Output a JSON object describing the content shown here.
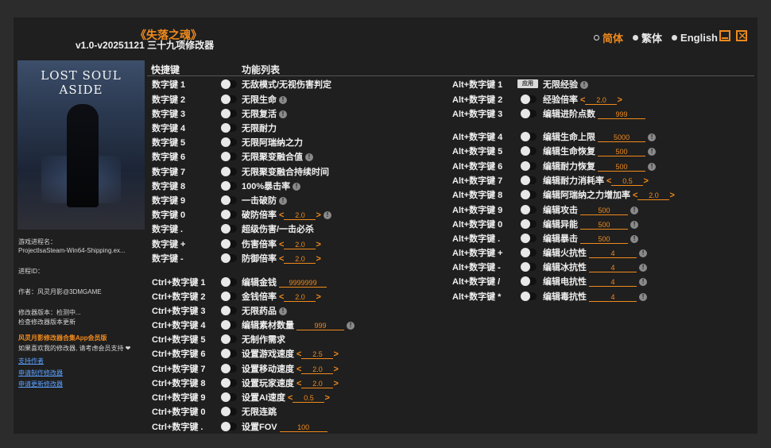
{
  "title": {
    "game": "《失落之魂》",
    "version": "v1.0-v20251121 三十九项修改器"
  },
  "languages": [
    {
      "label": "简体",
      "active": true
    },
    {
      "label": "繁体",
      "active": false
    },
    {
      "label": "English",
      "active": false
    }
  ],
  "window_controls": {
    "close_glyph": "✕"
  },
  "cover": {
    "title": "LOST SOUL ASIDE"
  },
  "info": {
    "process_label": "游戏进程名：",
    "process_name": "ProjectlsaSteam-Win64-Shipping.ex...",
    "pid_label": "进程ID：",
    "author": "作者：风灵月影@3DMGAME",
    "version_status": "修改器版本：检测中...",
    "check_update": "检查修改器版本更新",
    "promo": "风灵月影修改器合集App会员版",
    "support_text": "如果喜欢我的修改器, 请考虑会员支持 ❤",
    "links": [
      "支持作者",
      "申请制作修改器",
      "申请更新修改器"
    ]
  },
  "headers": {
    "hotkey": "快捷键",
    "features": "功能列表"
  },
  "icons": {
    "alert": "!",
    "left_arrow": "<",
    "right_arrow": ">",
    "apply": "应用"
  },
  "left_rows": [
    {
      "key": "数字键 1",
      "name": "无敌模式/无视伤害判定",
      "alert": false
    },
    {
      "key": "数字键 2",
      "name": "无限生命",
      "alert": true
    },
    {
      "key": "数字键 3",
      "name": "无限复活",
      "alert": true
    },
    {
      "key": "数字键 4",
      "name": "无限耐力",
      "alert": false
    },
    {
      "key": "数字键 5",
      "name": "无限阿瑞纳之力",
      "alert": false
    },
    {
      "key": "数字键 6",
      "name": "无限聚变融合值",
      "alert": true
    },
    {
      "key": "数字键 7",
      "name": "无限聚变融合持续时间",
      "alert": false
    },
    {
      "key": "数字键 8",
      "name": "100%暴击率",
      "alert": true
    },
    {
      "key": "数字键 9",
      "name": "一击破防",
      "alert": true
    },
    {
      "key": "数字键 0",
      "name": "破防倍率",
      "value": "2.0",
      "arrows": true,
      "alert": true
    },
    {
      "key": "数字键 .",
      "name": "超级伤害/一击必杀",
      "alert": false
    },
    {
      "key": "数字键 +",
      "name": "伤害倍率",
      "value": "2.0",
      "arrows": true,
      "alert": false
    },
    {
      "key": "数字键 -",
      "name": "防御倍率",
      "value": "2.0",
      "arrows": true,
      "alert": false
    },
    {
      "key": "Ctrl+数字键 1",
      "name": "编辑金钱",
      "value": "9999999",
      "arrows": false,
      "alert": false
    },
    {
      "key": "Ctrl+数字键 2",
      "name": "金钱倍率",
      "value": "2.0",
      "arrows": true,
      "alert": false
    },
    {
      "key": "Ctrl+数字键 3",
      "name": "无限药品",
      "alert": true
    },
    {
      "key": "Ctrl+数字键 4",
      "name": "编辑素材数量",
      "value": "999",
      "arrows": false,
      "alert": true
    },
    {
      "key": "Ctrl+数字键 5",
      "name": "无制作需求",
      "alert": false
    },
    {
      "key": "Ctrl+数字键 6",
      "name": "设置游戏速度",
      "value": "2.5",
      "arrows": true,
      "alert": false
    },
    {
      "key": "Ctrl+数字键 7",
      "name": "设置移动速度",
      "value": "2.0",
      "arrows": true,
      "alert": false
    },
    {
      "key": "Ctrl+数字键 8",
      "name": "设置玩家速度",
      "value": "2.0",
      "arrows": true,
      "alert": false
    },
    {
      "key": "Ctrl+数字键 9",
      "name": "设置AI速度",
      "value": "0.5",
      "arrows": true,
      "alert": false
    },
    {
      "key": "Ctrl+数字键 0",
      "name": "无限连跳",
      "alert": false
    },
    {
      "key": "Ctrl+数字键 .",
      "name": "设置FOV",
      "value": "100",
      "arrows": false,
      "alert": false
    }
  ],
  "right_rows": [
    {
      "key": "Alt+数字键 1",
      "name": "无限经验",
      "apply": true,
      "alert": true
    },
    {
      "key": "Alt+数字键 2",
      "name": "经验倍率",
      "value": "2.0",
      "arrows": true,
      "alert": false
    },
    {
      "key": "Alt+数字键 3",
      "name": "编辑进阶点数",
      "value": "999",
      "arrows": false,
      "alert": false
    },
    {
      "key": "Alt+数字键 4",
      "name": "编辑生命上限",
      "value": "5000",
      "arrows": false,
      "alert": true
    },
    {
      "key": "Alt+数字键 5",
      "name": "编辑生命恢复",
      "value": "500",
      "arrows": false,
      "alert": true
    },
    {
      "key": "Alt+数字键 6",
      "name": "编辑耐力恢复",
      "value": "500",
      "arrows": false,
      "alert": true
    },
    {
      "key": "Alt+数字键 7",
      "name": "编辑耐力消耗率",
      "value": "0.5",
      "arrows": true,
      "alert": false
    },
    {
      "key": "Alt+数字键 8",
      "name": "编辑阿瑞纳之力增加率",
      "value": "2.0",
      "arrows": true,
      "alert": false
    },
    {
      "key": "Alt+数字键 9",
      "name": "编辑攻击",
      "value": "500",
      "arrows": false,
      "alert": true
    },
    {
      "key": "Alt+数字键 0",
      "name": "编辑异能",
      "value": "500",
      "arrows": false,
      "alert": true
    },
    {
      "key": "Alt+数字键 .",
      "name": "编辑暴击",
      "value": "500",
      "arrows": false,
      "alert": true
    },
    {
      "key": "Alt+数字键 +",
      "name": "编辑火抗性",
      "value": "4",
      "arrows": false,
      "alert": true
    },
    {
      "key": "Alt+数字键 -",
      "name": "编辑冰抗性",
      "value": "4",
      "arrows": false,
      "alert": true
    },
    {
      "key": "Alt+数字键 /",
      "name": "编辑电抗性",
      "value": "4",
      "arrows": false,
      "alert": true
    },
    {
      "key": "Alt+数字键 *",
      "name": "编辑毒抗性",
      "value": "4",
      "arrows": false,
      "alert": true
    }
  ]
}
